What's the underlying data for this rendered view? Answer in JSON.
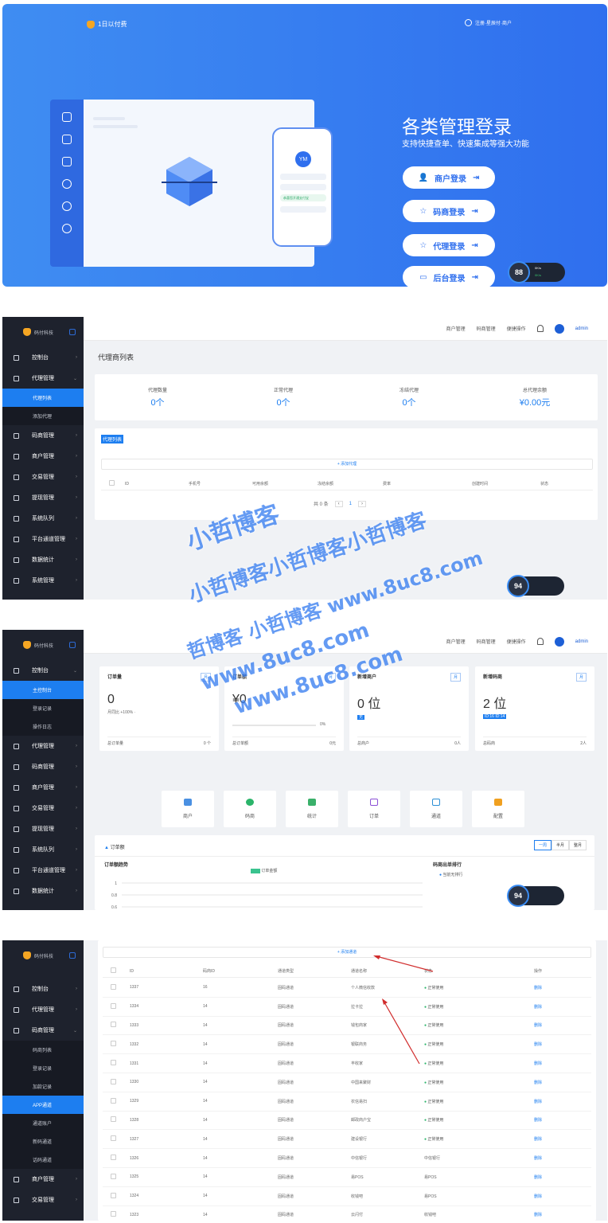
{
  "hero": {
    "brand": "1日以付费",
    "user": "注册·星辰付·商户",
    "phone_avatar": "YM",
    "phone_badge": "恭喜您开通支付宝",
    "title": "各类管理登录",
    "subtitle": "支持快捷查单、快速集成等强大功能",
    "buttons": [
      {
        "label": "商户登录",
        "icon": "user-icon"
      },
      {
        "label": "码商登录",
        "icon": "star-icon"
      },
      {
        "label": "代理登录",
        "icon": "star-icon"
      },
      {
        "label": "后台登录",
        "icon": "monitor-icon"
      }
    ],
    "speed": {
      "value": "88",
      "unit": "%",
      "up": "0K/s",
      "down": "0K/s"
    }
  },
  "brand_small": "码付科技",
  "topbar": {
    "merchant": "商户管理",
    "coder": "码商管理",
    "quick": "便捷操作",
    "user": "admin"
  },
  "panel2": {
    "sidebar": [
      {
        "label": "控制台"
      },
      {
        "label": "代理管理",
        "subs": [
          "代理列表",
          "添加代理"
        ]
      },
      {
        "label": "码商管理"
      },
      {
        "label": "商户管理"
      },
      {
        "label": "交易管理"
      },
      {
        "label": "提现管理"
      },
      {
        "label": "系统队列"
      },
      {
        "label": "平台通道管理"
      },
      {
        "label": "数据统计"
      },
      {
        "label": "系统管理"
      }
    ],
    "page_title": "代理商列表",
    "stats": [
      {
        "label": "代理数量",
        "value": "0个"
      },
      {
        "label": "正常代理",
        "value": "0个"
      },
      {
        "label": "冻结代理",
        "value": "0个"
      },
      {
        "label": "总代理余额",
        "value": "¥0.00元"
      }
    ],
    "list_title": "代理列表",
    "add_label": "+ 添加代理",
    "columns": [
      "ID",
      "手机号",
      "可用余额",
      "冻结余额",
      "费率",
      "创建时间",
      "状态"
    ],
    "pager": "共 0 条",
    "speed": {
      "value": "94",
      "unit": "%"
    }
  },
  "watermark": {
    "line1": "小哲博客",
    "line2": "小哲博客小哲博客小哲博客",
    "line3": "哲博客 小哲博客 www.8uc8.com",
    "line4": "www.8uc8.com",
    "line5": "www.8uc8.com"
  },
  "panel3": {
    "sidebar": [
      {
        "label": "控制台",
        "subs": [
          "主控制台",
          "登录记录",
          "操作日志"
        ]
      },
      {
        "label": "代理管理"
      },
      {
        "label": "码商管理"
      },
      {
        "label": "商户管理"
      },
      {
        "label": "交易管理"
      },
      {
        "label": "提现管理"
      },
      {
        "label": "系统队列"
      },
      {
        "label": "平台通道管理"
      },
      {
        "label": "数据统计"
      }
    ],
    "cards": [
      {
        "title": "订单量",
        "tag": "月",
        "value": "0",
        "sub": "月同比 +100% ·",
        "foot_l": "总订单量",
        "foot_r": "0 个"
      },
      {
        "title": "订单额",
        "tag": "月",
        "value": "¥0",
        "sub": "0%",
        "foot_l": "总订单额",
        "foot_r": "0元"
      },
      {
        "title": "新增商户",
        "tag": "月",
        "value": "0 位",
        "sub": "无",
        "foot_l": "总商户",
        "foot_r": "0人"
      },
      {
        "title": "新增码商",
        "tag": "月",
        "value": "2 位",
        "sub": "ID:16  ID:14",
        "foot_l": "总码商",
        "foot_r": "2人"
      }
    ],
    "quick": [
      "商户",
      "码商",
      "统计",
      "订单",
      "通道",
      "配置"
    ],
    "chart_section": "订单额",
    "ranges": [
      "一周",
      "半月",
      "整月"
    ],
    "chart_title": "订单额趋势",
    "legend": "订单金额",
    "rank_title": "码商出单排行",
    "rank_empty": "当前无排行",
    "yticks": [
      "1",
      "0.8",
      "0.6"
    ],
    "speed": {
      "value": "94",
      "unit": "%"
    }
  },
  "chart_data": {
    "type": "line",
    "title": "订单额趋势",
    "series": [
      {
        "name": "订单金额",
        "values": []
      }
    ],
    "yticks": [
      1,
      0.8,
      0.6
    ]
  },
  "panel4": {
    "sidebar_top": [
      {
        "label": "控制台"
      },
      {
        "label": "代理管理"
      },
      {
        "label": "码商管理",
        "subs": [
          "码商列表",
          "登录记录",
          "加款记录",
          "APP通道",
          "通道账户",
          "新码通道",
          "话码通道"
        ]
      }
    ],
    "sidebar_bottom": [
      {
        "label": "商户管理"
      },
      {
        "label": "交易管理"
      }
    ],
    "add_label": "+ 添加通道",
    "columns": [
      "ID",
      "码商ID",
      "通道类型",
      "通道名称",
      "状态",
      "操作"
    ],
    "rows": [
      [
        "1337",
        "16",
        "固码通道",
        "个人微信收款",
        "正常使用",
        "删除"
      ],
      [
        "1334",
        "14",
        "固码通道",
        "拉卡拉",
        "正常使用",
        "删除"
      ],
      [
        "1333",
        "14",
        "固码通道",
        "钱包商家",
        "正常使用",
        "删除"
      ],
      [
        "1332",
        "14",
        "固码通道",
        "银联商务",
        "正常使用",
        "删除"
      ],
      [
        "1331",
        "14",
        "固码通道",
        "丰收家",
        "正常使用",
        "删除"
      ],
      [
        "1330",
        "14",
        "固码通道",
        "中国来聚财",
        "正常使用",
        "删除"
      ],
      [
        "1329",
        "14",
        "固码通道",
        "农信易扫",
        "正常使用",
        "删除"
      ],
      [
        "1328",
        "14",
        "固码通道",
        "邮政商户宝",
        "正常使用",
        "删除"
      ],
      [
        "1327",
        "14",
        "固码通道",
        "建设银行",
        "正常使用",
        "删除"
      ],
      [
        "1326",
        "14",
        "固码通道",
        "中信银行",
        "中信银行",
        "删除"
      ],
      [
        "1325",
        "14",
        "固码通道",
        "易POS",
        "易POS",
        "删除"
      ],
      [
        "1324",
        "14",
        "固码通道",
        "收钱吧",
        "易POS",
        "删除"
      ],
      [
        "1323",
        "14",
        "固码通道",
        "云闪付",
        "收钱吧",
        "删除"
      ]
    ]
  }
}
